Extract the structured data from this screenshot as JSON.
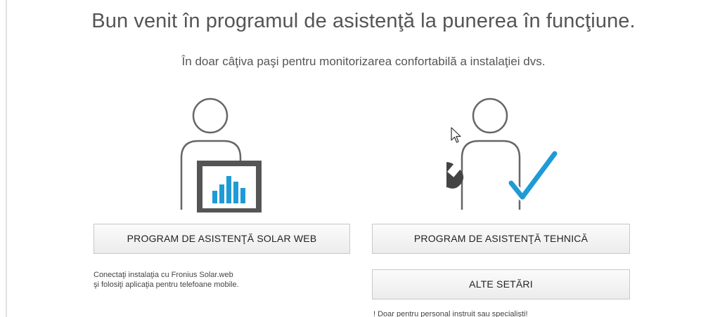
{
  "header": {
    "title": "Bun venit în programul de asistenţă la punerea în funcţiune.",
    "subtitle": "În doar câţiva paşi pentru monitorizarea confortabilă a instalaţiei dvs."
  },
  "solar_web": {
    "button_label": "PROGRAM DE ASISTENŢĂ SOLAR WEB",
    "note_line1": "Conectaţi instalaţia cu Fronius Solar.web",
    "note_line2": "şi folosiţi aplicaţia pentru telefoane mobile."
  },
  "technical": {
    "button_label": "PROGRAM DE ASISTENŢĂ TEHNICĂ"
  },
  "other": {
    "button_label": "ALTE SETĂRI",
    "note": "! Doar pentru personal instruit sau specialişti!"
  },
  "icons": {
    "solar_web_illustration": "person-with-chart-monitor-icon",
    "technical_illustration": "person-with-wrench-and-checkmark-icon",
    "cursor": "mouse-pointer-icon"
  },
  "colors": {
    "chart_bars": "#1e9bd7",
    "checkmark": "#1e9bd7",
    "text": "#555555",
    "button_border": "#c8c8c8"
  }
}
